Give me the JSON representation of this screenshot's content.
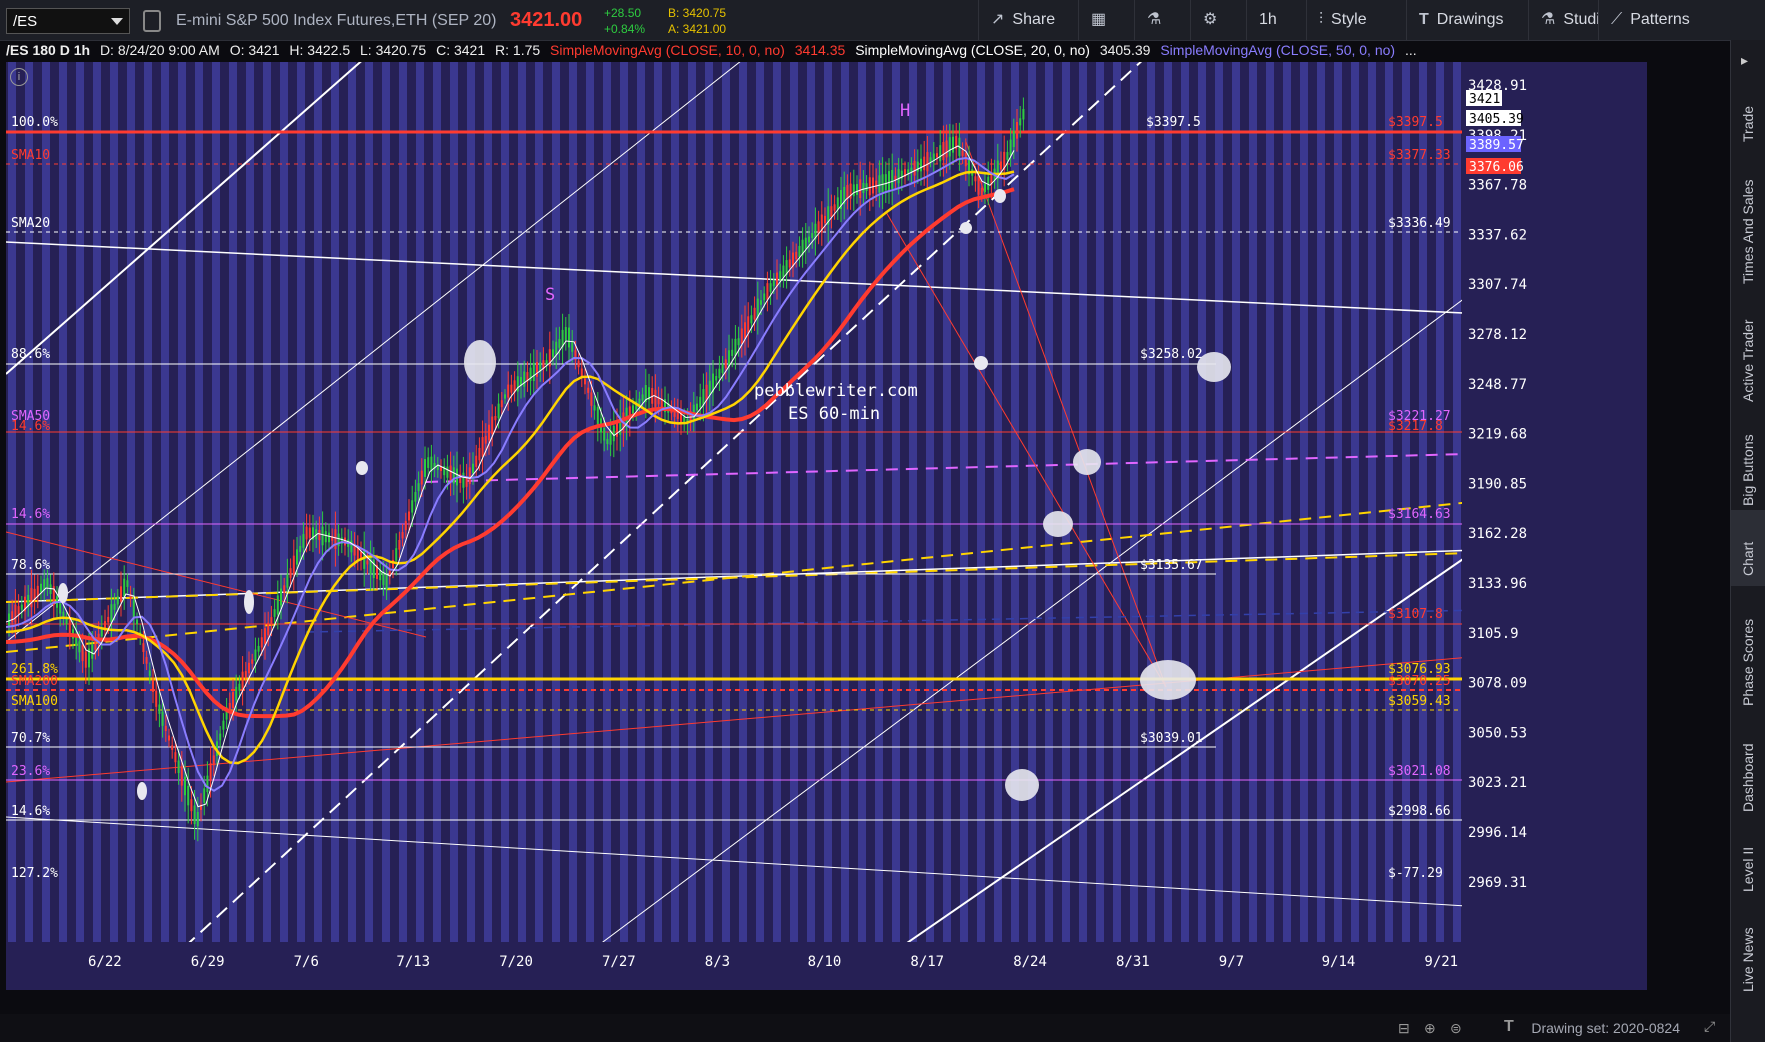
{
  "toolbar": {
    "symbol": "/ES",
    "description": "E-mini S&P 500 Index Futures,ETH (SEP 20)",
    "last_price": "3421.00",
    "change": "+28.50",
    "change_pct": "+0.84%",
    "bid": "B: 3420.75",
    "ask": "A: 3421.00",
    "share_label": "Share",
    "timeframe_label": "1h",
    "style_label": "Style",
    "drawings_label": "Drawings",
    "studies_label": "Studies",
    "patterns_label": "Patterns"
  },
  "legend": {
    "header": "/ES 180 D 1h",
    "date": "D: 8/24/20 9:00 AM",
    "open": "O: 3421",
    "high": "H: 3422.5",
    "low": "L: 3420.75",
    "close": "C: 3421",
    "range": "R: 1.75",
    "sma10": "SimpleMovingAvg (CLOSE, 10, 0, no)",
    "sma10_value": "3414.35",
    "sma20": "SimpleMovingAvg (CLOSE, 20, 0, no)",
    "sma20_value": "3405.39",
    "sma50": "SimpleMovingAvg (CLOSE, 50, 0, no)",
    "more": "..."
  },
  "price_axis": [
    "3428.91",
    "3398.21",
    "3367.78",
    "3337.62",
    "3307.74",
    "3278.12",
    "3248.77",
    "3219.68",
    "3190.85",
    "3162.28",
    "3133.96",
    "3105.9",
    "3078.09",
    "3050.53",
    "3023.21",
    "2996.14",
    "2969.31"
  ],
  "price_tags": {
    "last": "3421",
    "sma20": "3405.39",
    "sma50": "3389.57",
    "sma10": "3376.06"
  },
  "date_axis": [
    "6/22",
    "6/29",
    "7/6",
    "7/13",
    "7/20",
    "7/27",
    "8/3",
    "8/10",
    "8/17",
    "8/24",
    "8/31",
    "9/7",
    "9/14",
    "9/21"
  ],
  "left_labels": {
    "fib_100": "100.0%",
    "sma10": "SMA10",
    "sma20": "SMA20",
    "fib_886": "88.6%",
    "sma50": "SMA50",
    "fib_146a": "14.6%",
    "fib_146b": "14.6%",
    "fib_786": "78.6%",
    "fib_2618": "261.8%",
    "sma200": "SMA200",
    "sma100": "SMA100",
    "fib_707": "70.7%",
    "fib_236": "23.6%",
    "fib_146c": "14.6%",
    "fib_1272": "127.2%"
  },
  "right_labels": {
    "p3397": "$3397.5",
    "p3397b": "$3397.5",
    "p3377": "$3377.33",
    "p3336": "$3336.49",
    "p3258": "$3258.02",
    "p3221": "$3221.27",
    "p3217": "$3217.8",
    "p3164": "$3164.63",
    "p3135": "$3135.67",
    "p3107": "$3107.8",
    "p3076": "$3076.93",
    "p3070": "$3070.25",
    "p3059": "$3059.43",
    "p3039": "$3039.01",
    "p3021": "$3021.08",
    "p2998": "$2998.66",
    "p_neg": "$-77.29"
  },
  "annotations": {
    "s": "S",
    "h": "H",
    "watermark_1": "pebblewriter.com",
    "watermark_2": "ES 60-min"
  },
  "side_tabs": [
    "Trade",
    "Times And Sales",
    "Active Trader",
    "Big Buttons",
    "Chart",
    "Phase Scores",
    "Dashboard",
    "Level II",
    "Live News"
  ],
  "active_side_tab": "Chart",
  "drawing_set": "Drawing set: 2020-0824",
  "colors": {
    "background": "#262055",
    "vertical_band": "#3b3890",
    "price_up": "#2ecc40",
    "price_down": "#ff3b30",
    "sma10": "#ff3b30",
    "sma20": "#ffffff",
    "sma50": "#8a7dff",
    "fib_line": "#ffd400"
  }
}
